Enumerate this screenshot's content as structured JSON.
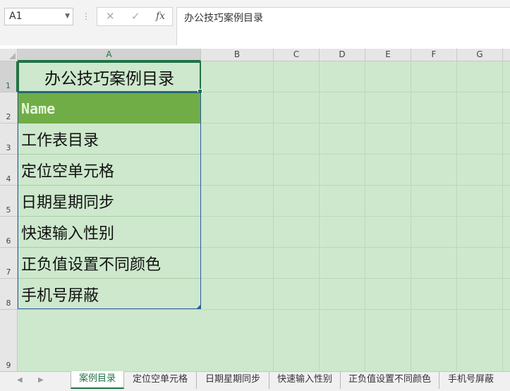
{
  "formula_bar": {
    "name_box": "A1",
    "cancel_glyph": "✕",
    "enter_glyph": "✓",
    "fx_label": "fx",
    "content": "办公技巧案例目录"
  },
  "columns": [
    "A",
    "B",
    "C",
    "D",
    "E",
    "F",
    "G"
  ],
  "rows": [
    "1",
    "2",
    "3",
    "4",
    "5",
    "6",
    "7",
    "8",
    "9"
  ],
  "cells": {
    "title": "办公技巧案例目录",
    "header": "Name",
    "items": [
      "工作表目录",
      "定位空单元格",
      "日期星期同步",
      "快速输入性别",
      "正负值设置不同颜色",
      "手机号屏蔽"
    ]
  },
  "sheet_tabs": {
    "nav_prev": "◀",
    "nav_next": "▶",
    "tabs": [
      "案例目录",
      "定位空单元格",
      "日期星期同步",
      "快速输入性别",
      "正负值设置不同颜色",
      "手机号屏蔽"
    ],
    "active_index": 0
  },
  "colors": {
    "selection": "#217346",
    "sheet_background": "#cde8cc",
    "header_fill": "#70ad47"
  }
}
